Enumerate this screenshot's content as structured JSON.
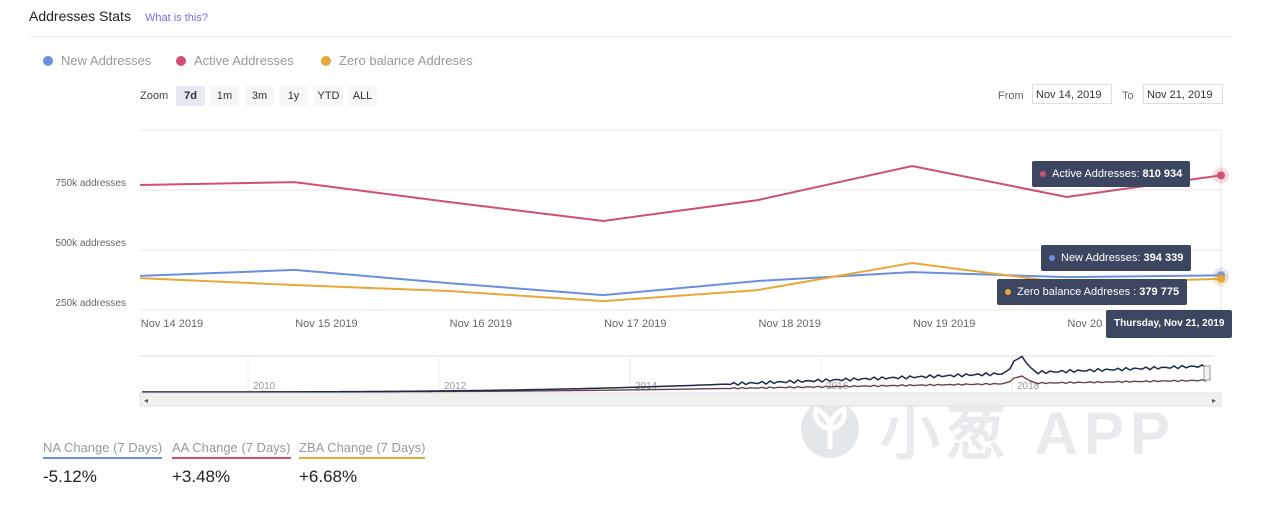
{
  "header": {
    "title": "Addresses Stats",
    "help_link": "What is this?"
  },
  "legend": [
    {
      "label": "New Addresses",
      "color": "#6a8fe0"
    },
    {
      "label": "Active Addresses",
      "color": "#d05070"
    },
    {
      "label": "Zero balance Addreses",
      "color": "#e8a838"
    }
  ],
  "range_selector": {
    "label": "Zoom",
    "buttons": [
      "7d",
      "1m",
      "3m",
      "1y",
      "YTD",
      "ALL"
    ],
    "selected": "7d",
    "from_label": "From",
    "from_value": "Nov 14, 2019",
    "to_label": "To",
    "to_value": "Nov 21, 2019"
  },
  "chart_data": {
    "type": "line",
    "x": [
      "Nov 14 2019",
      "Nov 15 2019",
      "Nov 16 2019",
      "Nov 17 2019",
      "Nov 18 2019",
      "Nov 19 2019",
      "Nov 20 2019",
      "Nov 21 2019"
    ],
    "x_tick_labels": [
      "Nov 14 2019",
      "Nov 15 2019",
      "Nov 16 2019",
      "Nov 17 2019",
      "Nov 18 2019",
      "Nov 19 2019",
      "Nov 20 2019"
    ],
    "y_tick_labels": [
      "250k addresses",
      "500k addresses",
      "750k addresses"
    ],
    "ylim": [
      250000,
      1000000
    ],
    "grid": true,
    "legend_position": "top-left",
    "series": [
      {
        "name": "New Addresses",
        "color": "#6a8fe0",
        "values": [
          392000,
          417000,
          362000,
          312000,
          371000,
          408000,
          387000,
          394339
        ]
      },
      {
        "name": "Active Addresses",
        "color": "#d05070",
        "values": [
          771000,
          783000,
          700000,
          621000,
          708000,
          850000,
          721000,
          810934
        ]
      },
      {
        "name": "Zero balance Addreses",
        "color": "#e8a838",
        "values": [
          383000,
          354000,
          329000,
          287000,
          333000,
          446000,
          362000,
          379775
        ]
      }
    ],
    "tooltip": {
      "date": "Thursday, Nov 21, 2019",
      "rows": [
        {
          "label": "Active Addresses: ",
          "value": "810 934",
          "color": "#d05070"
        },
        {
          "label": "New Addresses: ",
          "value": "394 339",
          "color": "#6a8fe0"
        },
        {
          "label": "Zero balance Addreses : ",
          "value": "379 775",
          "color": "#e8a838"
        }
      ]
    },
    "navigator_labels": [
      "2010",
      "2012",
      "2014",
      "2016",
      "2018"
    ]
  },
  "stats": [
    {
      "label": "NA Change (7 Days)",
      "value": "-5.12%",
      "color": "#6a8fe0"
    },
    {
      "label": "AA Change (7 Days)",
      "value": "+3.48%",
      "color": "#d05070"
    },
    {
      "label": "ZBA Change (7 Days)",
      "value": "+6.68%",
      "color": "#e8a838"
    }
  ],
  "watermark": "小葱 APP"
}
